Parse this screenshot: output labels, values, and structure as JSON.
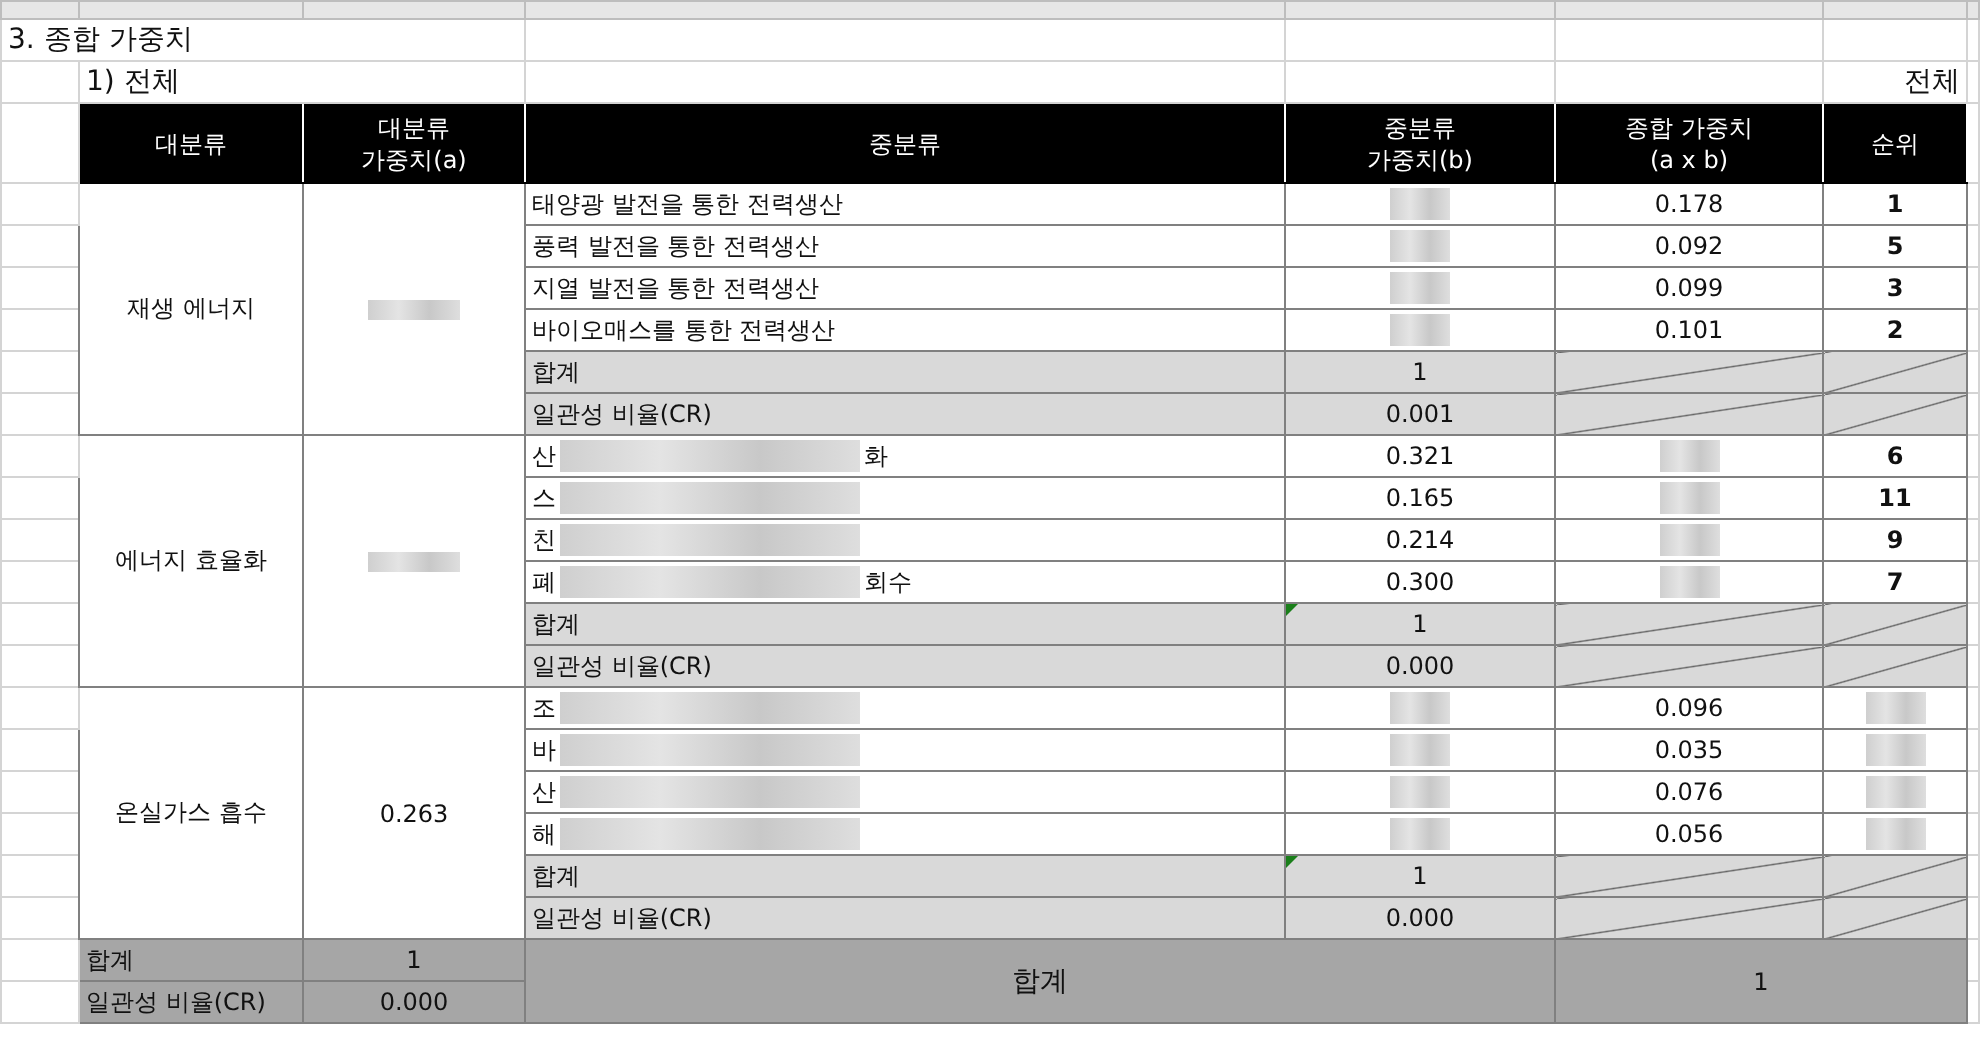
{
  "title": "3. 종합 가중치",
  "subtitle": "1) 전체",
  "scope_label": "전체",
  "columns": [
    [
      "대분류"
    ],
    [
      "대분류",
      "가중치(a)"
    ],
    [
      "중분류"
    ],
    [
      "중분류",
      "가중치(b)"
    ],
    [
      "종합 가중치",
      "(a x b)"
    ],
    [
      "순위"
    ]
  ],
  "groups": [
    {
      "name": "재생 에너지",
      "weight": {
        "redacted": true
      },
      "rows": [
        {
          "name": {
            "text": "태양광 발전을 통한 전력생산"
          },
          "b": {
            "redacted": true
          },
          "ab": {
            "text": "0.178"
          },
          "rank": {
            "text": "1"
          }
        },
        {
          "name": {
            "text": "풍력 발전을 통한 전력생산"
          },
          "b": {
            "redacted": true
          },
          "ab": {
            "text": "0.092"
          },
          "rank": {
            "text": "5"
          }
        },
        {
          "name": {
            "text": "지열 발전을 통한 전력생산"
          },
          "b": {
            "redacted": true
          },
          "ab": {
            "text": "0.099"
          },
          "rank": {
            "text": "3"
          }
        },
        {
          "name": {
            "text": "바이오매스를 통한 전력생산"
          },
          "b": {
            "redacted": true
          },
          "ab": {
            "text": "0.101"
          },
          "rank": {
            "text": "2"
          }
        }
      ],
      "sum_label": "합계",
      "sum": "1",
      "error_marker": false,
      "cr_label": "일관성 비율(CR)",
      "cr": "0.001"
    },
    {
      "name": "에너지 효율화",
      "weight": {
        "redacted": true
      },
      "rows": [
        {
          "name": {
            "text": "산",
            "suffix": "화",
            "redacted": true
          },
          "b": {
            "text": "0.321"
          },
          "ab": {
            "redacted": true
          },
          "rank": {
            "text": "6"
          }
        },
        {
          "name": {
            "text": "스",
            "redacted": true
          },
          "b": {
            "text": "0.165"
          },
          "ab": {
            "redacted": true
          },
          "rank": {
            "text": "11"
          }
        },
        {
          "name": {
            "text": "친",
            "redacted": true
          },
          "b": {
            "text": "0.214"
          },
          "ab": {
            "redacted": true
          },
          "rank": {
            "text": "9"
          }
        },
        {
          "name": {
            "text": "폐",
            "suffix": "회수",
            "redacted": true
          },
          "b": {
            "text": "0.300"
          },
          "ab": {
            "redacted": true
          },
          "rank": {
            "text": "7"
          }
        }
      ],
      "sum_label": "합계",
      "sum": "1",
      "error_marker": true,
      "cr_label": "일관성 비율(CR)",
      "cr": "0.000"
    },
    {
      "name": "온실가스 흡수",
      "weight": {
        "text": "0.263"
      },
      "rows": [
        {
          "name": {
            "text": "조",
            "redacted": true
          },
          "b": {
            "redacted": true
          },
          "ab": {
            "text": "0.096"
          },
          "rank": {
            "redacted": true
          }
        },
        {
          "name": {
            "text": "바",
            "redacted": true
          },
          "b": {
            "redacted": true
          },
          "ab": {
            "text": "0.035"
          },
          "rank": {
            "redacted": true
          }
        },
        {
          "name": {
            "text": "산",
            "redacted": true
          },
          "b": {
            "redacted": true
          },
          "ab": {
            "text": "0.076"
          },
          "rank": {
            "redacted": true
          }
        },
        {
          "name": {
            "text": "해",
            "redacted": true
          },
          "b": {
            "redacted": true
          },
          "ab": {
            "text": "0.056"
          },
          "rank": {
            "redacted": true
          }
        }
      ],
      "sum_label": "합계",
      "sum": "1",
      "error_marker": true,
      "cr_label": "일관성 비율(CR)",
      "cr": "0.000"
    }
  ],
  "footer": {
    "sum_label": "합계",
    "sum": "1",
    "cr_label": "일관성 비율(CR)",
    "cr": "0.000",
    "total_label": "합계",
    "total": "1"
  }
}
